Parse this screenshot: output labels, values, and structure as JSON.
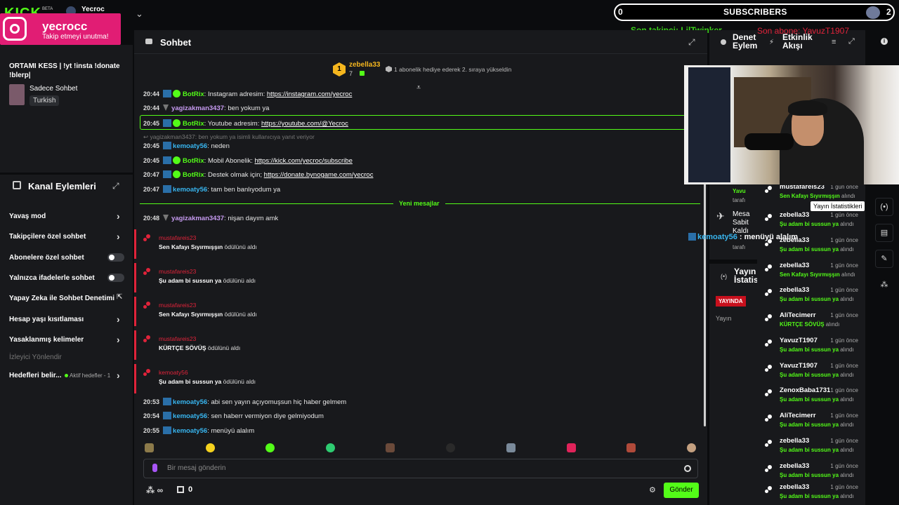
{
  "topbar": {
    "user": "Yecroc",
    "beta": "BETA",
    "logo": "KICK"
  },
  "instagram": {
    "name": "yecrocc",
    "sub": "Takip etmeyi unutma!"
  },
  "subscribers": {
    "left": "0",
    "label": "SUBSCRIBERS",
    "right": "2"
  },
  "last_follower": "Son takipçi: LilTwinker",
  "last_sub": "Son abone: YavuzT1907",
  "stream_info": {
    "title": "ORTAMI KESS | !yt !insta !donate !blerp|",
    "category": "Sadece Sohbet",
    "tag": "Turkish"
  },
  "kanal": {
    "title": "Kanal Eylemleri",
    "items": [
      {
        "label": "Yavaş mod",
        "ctl": "chev"
      },
      {
        "label": "Takipçilere özel sohbet",
        "ctl": "chev"
      },
      {
        "label": "Abonelere özel sohbet",
        "ctl": "toggle"
      },
      {
        "label": "Yalnızca ifadelerle sohbet",
        "ctl": "toggle"
      },
      {
        "label": "Yapay Zeka ile Sohbet Denetimi",
        "ctl": "ext"
      },
      {
        "label": "Hesap yaşı kısıtlaması",
        "ctl": "chev"
      },
      {
        "label": "Yasaklanmış kelimeler",
        "ctl": "chev"
      }
    ],
    "viewer": "İzleyici Yönlendir",
    "goals": "Hedefleri belir...",
    "goals_sub": "Aktif hedefler - 1"
  },
  "chat": {
    "title": "Sohbet",
    "pinned": {
      "rank": "1",
      "user": "zebella33",
      "count": "7",
      "msg": "1 abonelik hediye ederek 2. sıraya yükseldin"
    },
    "messages": [
      {
        "time": "20:44",
        "user": "BotRix",
        "cls": "u-bot",
        "text": "Instagram adresim: ",
        "link": "https://instagram.com/yecroc",
        "badge": "kv"
      },
      {
        "time": "20:44",
        "user": "yagizakman3437",
        "cls": "u-yag",
        "text": "ben yokum ya",
        "link": "",
        "badge": "y"
      },
      {
        "time": "20:45",
        "user": "BotRix",
        "cls": "u-bot",
        "text": "Youtube adresim: ",
        "link": "https://youtube.com/@Yecroc",
        "badge": "kv"
      },
      {
        "time": "20:45",
        "user": "kemoaty56",
        "cls": "u-kem",
        "text": "neden",
        "link": "",
        "badge": "k"
      },
      {
        "time": "20:45",
        "user": "BotRix",
        "cls": "u-bot",
        "text": "Mobil Abonelik: ",
        "link": "https://kick.com/yecroc/subscribe",
        "badge": "kv"
      },
      {
        "time": "20:47",
        "user": "BotRix",
        "cls": "u-bot",
        "text": "Destek olmak için; ",
        "link": "https://donate.bynogame.com/yecroc",
        "badge": "kv"
      },
      {
        "time": "20:47",
        "user": "kemoaty56",
        "cls": "u-kem",
        "text": "tam ben banlıyodum ya",
        "link": "",
        "badge": "k"
      },
      {
        "time": "20:48",
        "user": "yagizakman3437",
        "cls": "u-yag",
        "text": "nişan dayım amk",
        "link": "",
        "badge": "y"
      }
    ],
    "reply": "yagizakman3437: ben yokum ya isimli kullanıcıya yanıt veriyor",
    "new_label": "Yeni mesajlar",
    "rewards": [
      {
        "user": "mustafareis23",
        "reward": "Sen Kafayı Sıyırmışşın",
        "suffix": " ödülünü aldı"
      },
      {
        "user": "mustafareis23",
        "reward": "Şu adam bi sussun ya",
        "suffix": " ödülünü aldı"
      },
      {
        "user": "mustafareis23",
        "reward": "Sen Kafayı Sıyırmışşın",
        "suffix": " ödülünü aldı"
      },
      {
        "user": "mustafareis23",
        "reward": "KÜRTÇE SÖVÜŞ",
        "suffix": " ödülünü aldı"
      },
      {
        "user": "kemoaty56",
        "reward": "Şu adam bi sussun ya",
        "suffix": " ödülünü aldı"
      }
    ],
    "later": [
      {
        "time": "20:53",
        "user": "kemoaty56",
        "text": "abi sen yayın açıyomuşsun hiç haber gelmem"
      },
      {
        "time": "20:54",
        "user": "kemoaty56",
        "text": "sen haberr vermiyon diye gelmiyodum"
      },
      {
        "time": "20:55",
        "user": "kemoaty56",
        "text": "menüyü alalım"
      }
    ],
    "placeholder": "Bir mesaj gönderin",
    "points": "∞",
    "gifts": "0",
    "send": "Gönder"
  },
  "panel3": {
    "title_a": "Denet",
    "title_b": "Eylem",
    "mesa": [
      "Mesa",
      "Sabit",
      "Kaldı"
    ],
    "tarafi": "tarafı",
    "yayin_a": "Yayın",
    "yayin_b": "İstatis",
    "live": "YAYINDA",
    "yayin": "Yayın",
    "name_partial": "Yavu"
  },
  "activity": {
    "title_a": "Etkinlik",
    "title_b": "Akışı",
    "tooltip": "Yayın İstatistikleri",
    "events": [
      {
        "name": "mustafareis23",
        "time": "1 gün önce",
        "reward": "Sen Kafayı Sıyırmışşın",
        "suffix": " alındı"
      },
      {
        "name": "zebella33",
        "time": "1 gün önce",
        "reward": "Şu adam bi sussun ya",
        "suffix": " alındı"
      },
      {
        "name": "zebella33",
        "time": "1 gün önce",
        "reward": "Şu adam bi sussun ya",
        "suffix": " alındı"
      },
      {
        "name": "zebella33",
        "time": "1 gün önce",
        "reward": "Sen Kafayı Sıyırmışşın",
        "suffix": " alındı"
      },
      {
        "name": "zebella33",
        "time": "1 gün önce",
        "reward": "Şu adam bi sussun ya",
        "suffix": " alındı"
      },
      {
        "name": "AliTecimerr",
        "time": "1 gün önce",
        "reward": "KÜRTÇE SÖVÜŞ",
        "suffix": " alındı"
      },
      {
        "name": "YavuzT1907",
        "time": "1 gün önce",
        "reward": "Şu adam bi sussun ya",
        "suffix": " alındı"
      },
      {
        "name": "YavuzT1907",
        "time": "1 gün önce",
        "reward": "Şu adam bi sussun ya",
        "suffix": " alındı"
      },
      {
        "name": "ZenoxBaba1731",
        "time": "1 gün önce",
        "reward": "Şu adam bi sussun ya",
        "suffix": " alındı"
      },
      {
        "name": "AliTecimerr",
        "time": "1 gün önce",
        "reward": "Şu adam bi sussun ya",
        "suffix": " alındı"
      },
      {
        "name": "zebella33",
        "time": "1 gün önce",
        "reward": "Şu adam bi sussun ya",
        "suffix": " alındı"
      },
      {
        "name": "zebella33",
        "time": "1 gün önce",
        "reward": "Şu adam bi sussun ya",
        "suffix": " alındı"
      },
      {
        "name": "zebella33",
        "time": "1 gün önce",
        "reward": "Şu adam bi sussun ya",
        "suffix": " alındı"
      }
    ]
  },
  "overlay": {
    "user": "kemoaty56",
    "text": " : menüyü alalım"
  },
  "colors": {
    "accent": "#53fc18",
    "reward": "#e0233a",
    "kemo": "#38b6f0",
    "bot": "#53fc18",
    "yagiz": "#c79bf2",
    "gold": "#f5b61e"
  }
}
